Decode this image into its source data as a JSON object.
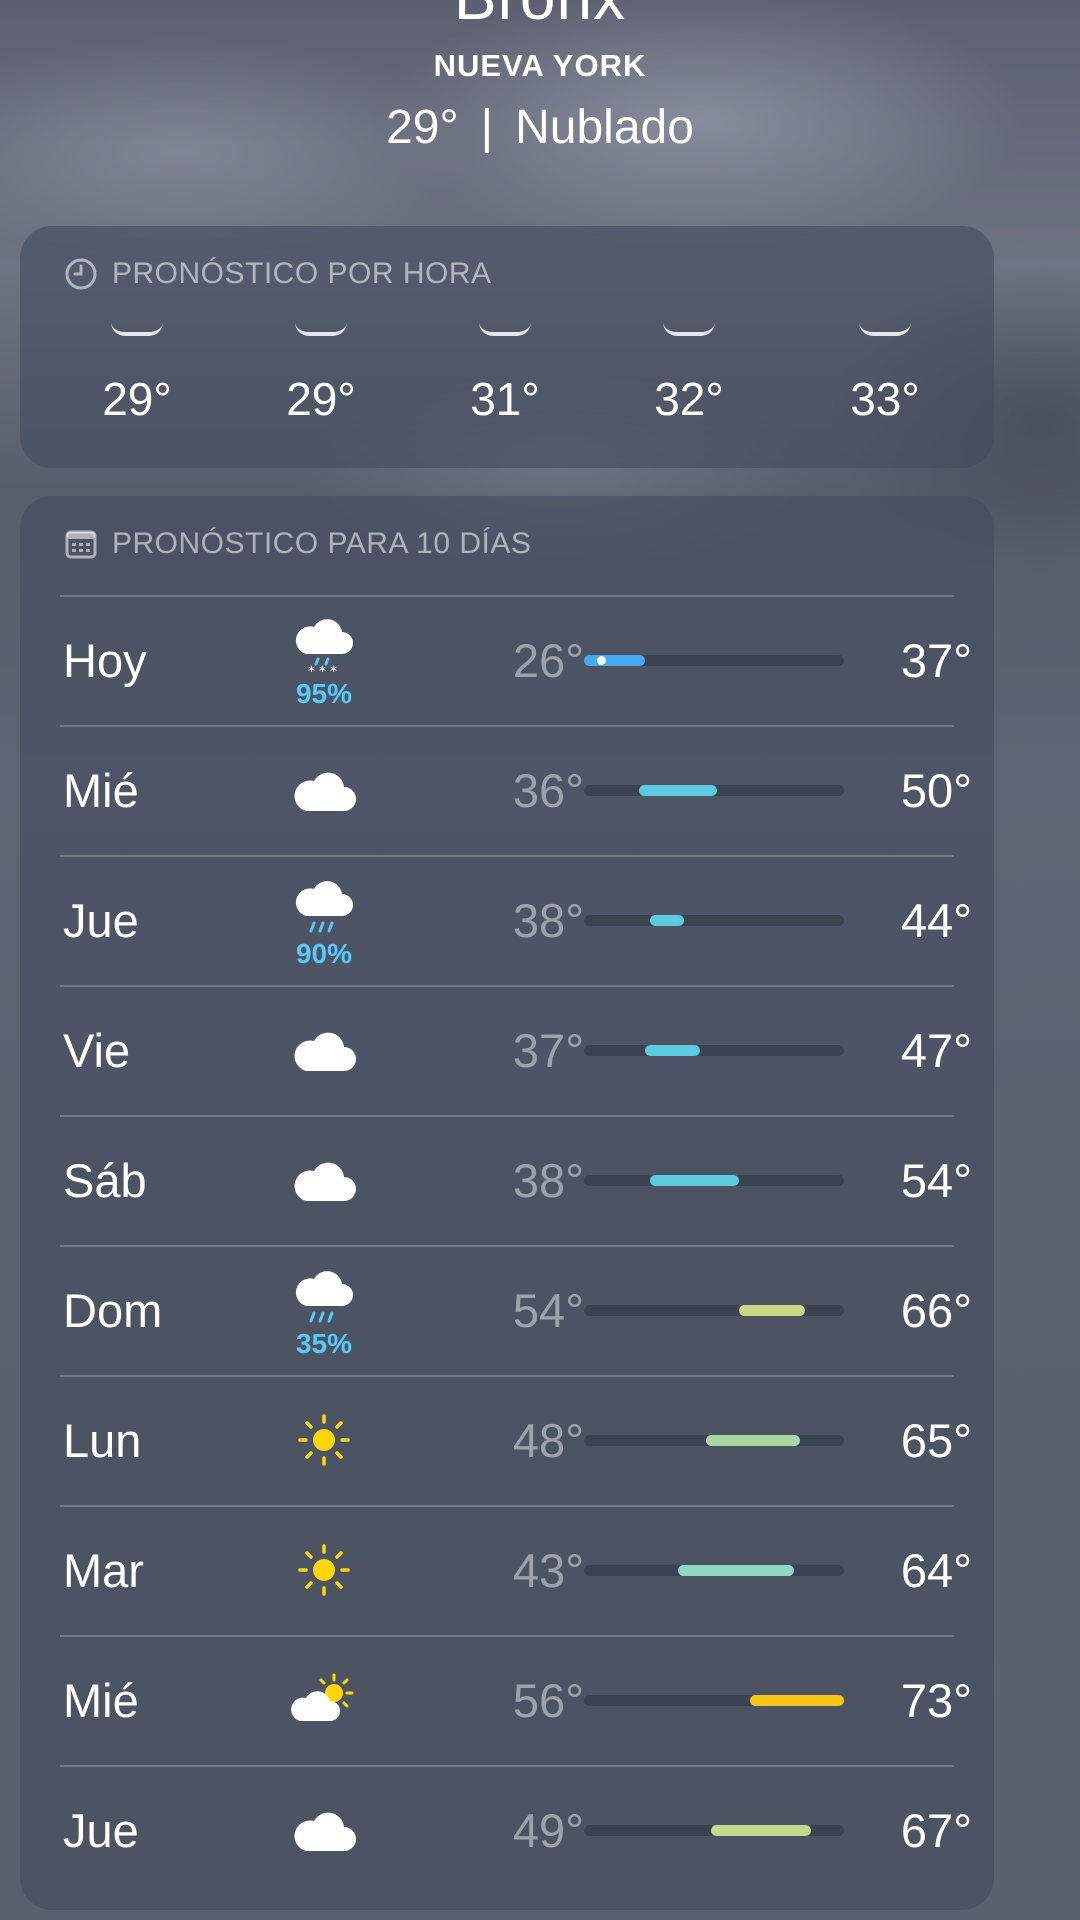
{
  "header": {
    "city": "Bronx",
    "state": "NUEVA YORK",
    "current_temp": "29°",
    "separator": "|",
    "condition": "Nublado"
  },
  "hourly": {
    "title": "PRONÓSTICO POR HORA",
    "icon": "clock-icon",
    "temps": [
      "29°",
      "29°",
      "31°",
      "32°",
      "33°"
    ]
  },
  "daily": {
    "title": "PRONÓSTICO PARA 10 DÍAS",
    "icon": "calendar-icon",
    "range_min": 26,
    "range_max": 73,
    "current_temp_value": 29,
    "days": [
      {
        "day": "Hoy",
        "icon": "cloud-snow-icon",
        "precip": "95%",
        "low": "26°",
        "high": "37°",
        "low_v": 26,
        "high_v": 37,
        "color": "#4aa8f0",
        "show_current": true
      },
      {
        "day": "Mié",
        "icon": "cloud-icon",
        "precip": "",
        "low": "36°",
        "high": "50°",
        "low_v": 36,
        "high_v": 50,
        "color": "#5ccbe0"
      },
      {
        "day": "Jue",
        "icon": "cloud-rain-icon",
        "precip": "90%",
        "low": "38°",
        "high": "44°",
        "low_v": 38,
        "high_v": 44,
        "color": "#5ccbe0"
      },
      {
        "day": "Vie",
        "icon": "cloud-icon",
        "precip": "",
        "low": "37°",
        "high": "47°",
        "low_v": 37,
        "high_v": 47,
        "color": "#5ccbe0"
      },
      {
        "day": "Sáb",
        "icon": "cloud-icon",
        "precip": "",
        "low": "38°",
        "high": "54°",
        "low_v": 38,
        "high_v": 54,
        "color": "#5ccbe0"
      },
      {
        "day": "Dom",
        "icon": "cloud-rain-icon",
        "precip": "35%",
        "low": "54°",
        "high": "66°",
        "low_v": 54,
        "high_v": 66,
        "color": "#c9d884"
      },
      {
        "day": "Lun",
        "icon": "sun-icon",
        "precip": "",
        "low": "48°",
        "high": "65°",
        "low_v": 48,
        "high_v": 65,
        "color": "#a9d6a2"
      },
      {
        "day": "Mar",
        "icon": "sun-icon",
        "precip": "",
        "low": "43°",
        "high": "64°",
        "low_v": 43,
        "high_v": 64,
        "color": "#8fd9c4"
      },
      {
        "day": "Mié",
        "icon": "partly-cloudy-icon",
        "precip": "",
        "low": "56°",
        "high": "73°",
        "low_v": 56,
        "high_v": 73,
        "color": "#f5c518"
      },
      {
        "day": "Jue",
        "icon": "cloud-icon",
        "precip": "",
        "low": "49°",
        "high": "67°",
        "low_v": 49,
        "high_v": 67,
        "color": "#c4d98c"
      }
    ]
  }
}
